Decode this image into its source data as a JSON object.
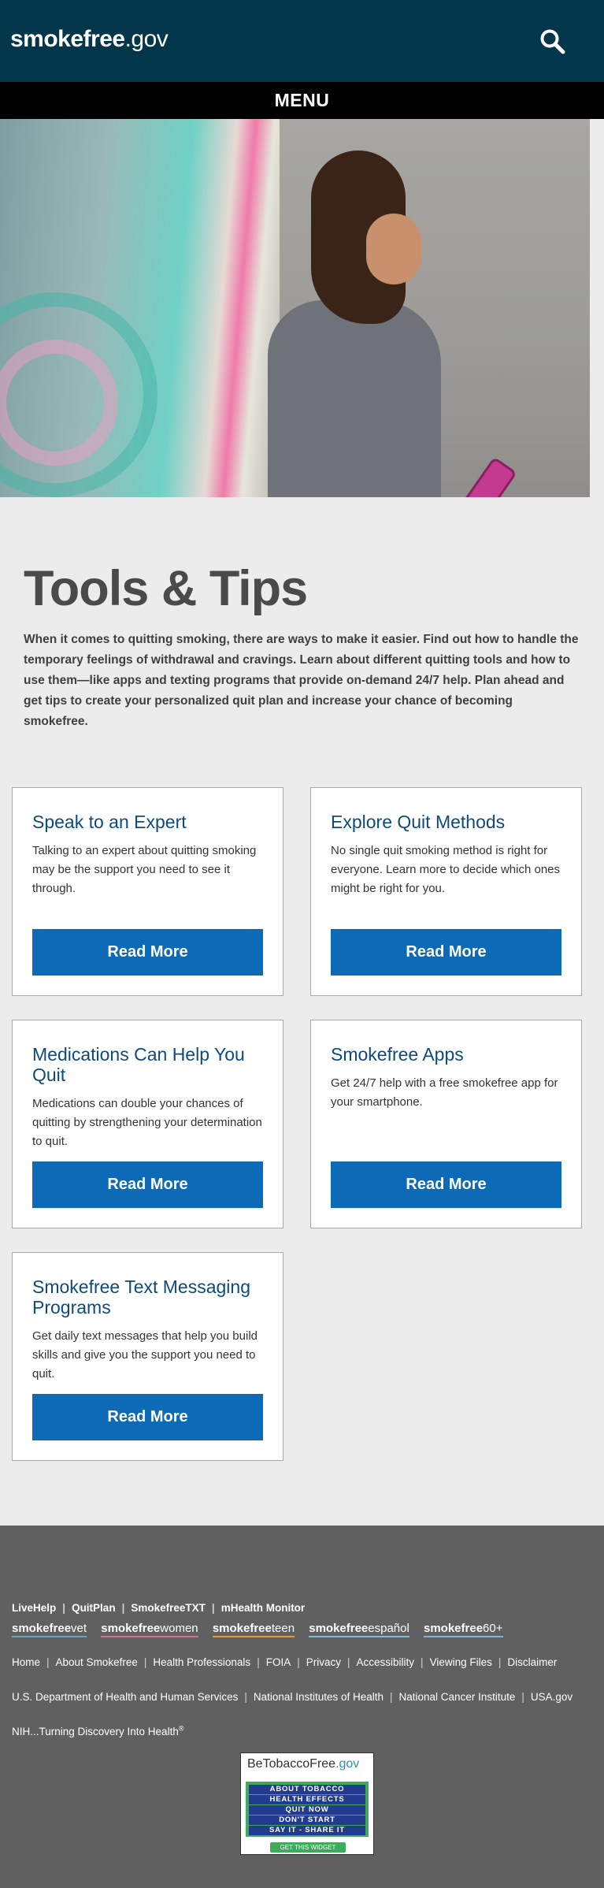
{
  "header": {
    "logo_bold": "smokefree",
    "logo_light": ".gov"
  },
  "menu": {
    "label": "MENU"
  },
  "page": {
    "title": "Tools & Tips",
    "intro": "When it comes to quitting smoking, there are ways to make it easier. Find out how to handle the temporary feelings of withdrawal and cravings. Learn about different quitting tools and how to use them—like apps and texting programs that provide on-demand 24/7 help. Plan ahead and get tips to create your personalized quit plan and increase your chance of becoming smokefree."
  },
  "cards": [
    {
      "title": "Speak to an Expert",
      "text": "Talking to an expert about quitting smoking may be the support you need to see it through.",
      "button": "Read More"
    },
    {
      "title": "Explore Quit Methods",
      "text": "No single quit smoking method is right for everyone. Learn more to decide which ones might be right for you.",
      "button": "Read More"
    },
    {
      "title": "Medications Can Help You Quit",
      "text": "Medications can double your chances of quitting by strengthening your determination to quit.",
      "button": "Read More"
    },
    {
      "title": "Smokefree Apps",
      "text": "Get 24/7 help with a free smokefree app for your smartphone.",
      "button": "Read More"
    },
    {
      "title": "Smokefree Text Messaging Programs",
      "text": "Get daily text messages that help you build skills and give you the support you need to quit.",
      "button": "Read More"
    }
  ],
  "footer": {
    "quick_links": [
      "LiveHelp",
      "QuitPlan",
      "SmokefreeTXT",
      "mHealth Monitor"
    ],
    "brands": [
      {
        "bold": "smokefree",
        "light": "vet"
      },
      {
        "bold": "smokefree",
        "light": "women"
      },
      {
        "bold": "smokefree",
        "light": "teen"
      },
      {
        "bold": "smokefree",
        "light": "español"
      },
      {
        "bold": "smokefree",
        "light": "60+"
      }
    ],
    "site_links": [
      "Home",
      "About Smokefree",
      "Health Professionals",
      "FOIA",
      "Privacy",
      "Accessibility",
      "Viewing Files",
      "Disclaimer"
    ],
    "gov_links": [
      "U.S. Department of Health and Human Services",
      "National Institutes of Health",
      "National Cancer Institute",
      "USA.gov"
    ],
    "tagline": "NIH...Turning Discovery Into Health",
    "tagline_mark": "®",
    "widget": {
      "title_main": "BeTobaccoFree",
      "title_suffix": ".gov",
      "items": [
        "ABOUT TOBACCO",
        "HEALTH EFFECTS",
        "QUIT NOW",
        "DON'T START",
        "SAY IT - SHARE IT"
      ],
      "get_label": "GET THIS WIDGET"
    }
  }
}
